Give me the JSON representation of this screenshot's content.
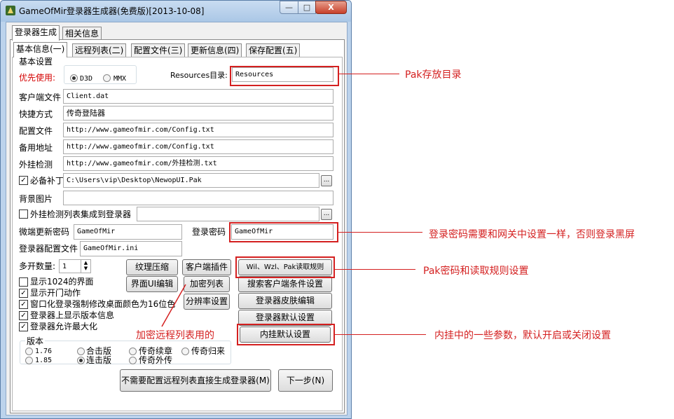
{
  "window": {
    "title": "GameOfMir登录器生成器(免费版)[2013-10-08]",
    "min_glyph": "—",
    "max_glyph": "□",
    "close_glyph": "X"
  },
  "outer_tabs": [
    "登录器生成",
    "相关信息"
  ],
  "inner_tabs": [
    "基本信息(一)",
    "远程列表(二)",
    "配置文件(三)",
    "更新信息(四)",
    "保存配置(五)"
  ],
  "basic": {
    "section_label": "基本设置",
    "priority_label": "优先使用:",
    "d3d": "D3D",
    "mmx": "MMX",
    "resources_label": "Resources目录:",
    "resources_value": "Resources"
  },
  "fields": {
    "client_file_label": "客户端文件",
    "client_file_value": "Client.dat",
    "shortcut_label": "快捷方式",
    "shortcut_value": "传奇登陆器",
    "config_label": "配置文件",
    "config_value": "http://www.gameofmir.com/Config.txt",
    "backup_label": "备用地址",
    "backup_value": "http://www.gameofmir.com/Config.txt",
    "plugin_check_label": "外挂检测",
    "plugin_check_value": "http://www.gameofmir.com/外挂检测.txt",
    "patch_label": "必备补丁",
    "patch_value": "C:\\Users\\vip\\Desktop\\NewopUI.Pak",
    "bg_label": "背景图片",
    "bg_value": "",
    "integrate_label": "外挂检测列表集成到登录器",
    "integrate_value": "",
    "micro_pwd_label": "微端更新密码",
    "micro_pwd_value": "GameOfMir",
    "login_pwd_label": "登录密码",
    "login_pwd_value": "GameOfMir",
    "launcher_cfg_label": "登录器配置文件",
    "launcher_cfg_value": "GameOfMir.ini",
    "multi_label": "多开数量:",
    "multi_value": "1",
    "browse": "..."
  },
  "buttons": {
    "texture": "纹理压缩",
    "client_plugin": "客户端插件",
    "wil_rule": "Wil、Wzl、Pak读取规则",
    "ui_edit": "界面UI编辑",
    "encrypt_list": "加密列表",
    "search_cond": "搜索客户端条件设置",
    "resolution": "分辨率设置",
    "skin_edit": "登录器皮肤编辑",
    "default_set": "登录器默认设置",
    "builtin_default": "内挂默认设置",
    "direct_gen": "不需要配置远程列表直接生成登录器(M)",
    "next": "下一步(N)"
  },
  "checks": [
    {
      "label": "显示1024的界面",
      "checked": false
    },
    {
      "label": "显示开门动作",
      "checked": true
    },
    {
      "label": "窗口化登录强制修改桌面颜色为16位色",
      "checked": true
    },
    {
      "label": "登录器上显示版本信息",
      "checked": true
    },
    {
      "label": "登录器允许最大化",
      "checked": true
    }
  ],
  "version": {
    "label": "版本",
    "options": [
      "1.76",
      "合击版",
      "传奇续章",
      "传奇归来",
      "1.85",
      "连击版",
      "传奇外传"
    ]
  },
  "annotations": {
    "pak_dir": "Pak存放目录",
    "login_pwd": "登录密码需要和网关中设置一样，否则登录黑屏",
    "pak_pwd": "Pak密码和读取规则设置",
    "encrypt_remote": "加密远程列表用的",
    "builtin": "内挂中的一些参数，默认开启或关闭设置"
  },
  "colors": {
    "annotation_red": "#d42020",
    "label_red": "#d40000",
    "titlebar": "#bcd3ec"
  }
}
